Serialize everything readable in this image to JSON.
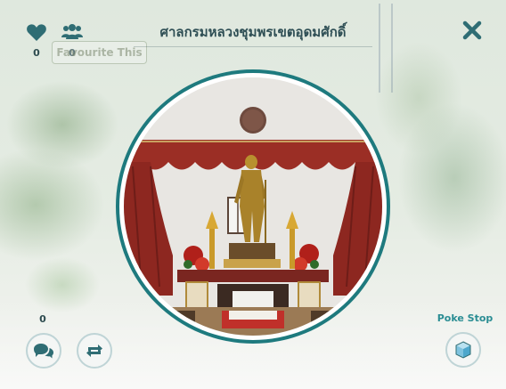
{
  "header": {
    "title": "ศาลกรมหลวงชุมพรเขตอุดมศักดิ์",
    "likes_count": "0",
    "friends_count": "0",
    "favourite_label": "Favourite This"
  },
  "footer": {
    "comments_count": "0",
    "pokestop_label": "Poke Stop"
  },
  "colors": {
    "accent": "#2a8d93",
    "ring": "#1e7a7e",
    "icon": "#2f5f66"
  },
  "icons": [
    "heart-icon",
    "people-icon",
    "close-icon",
    "comment-icon",
    "share-icon",
    "cube-icon"
  ]
}
